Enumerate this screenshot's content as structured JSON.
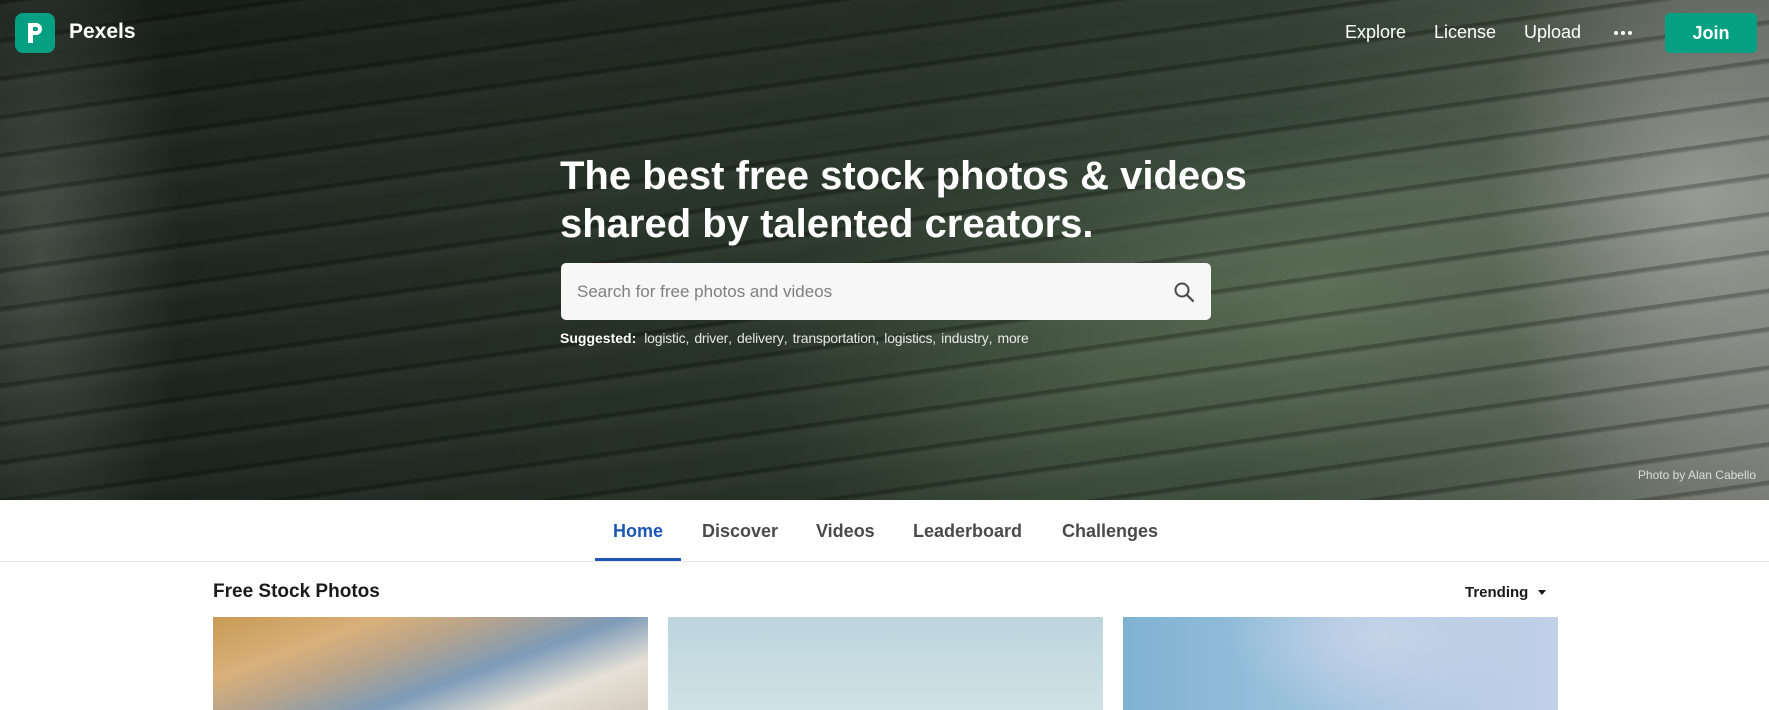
{
  "app": {
    "brand": "Pexels",
    "logo_letter": "P"
  },
  "nav": {
    "links": [
      "Explore",
      "License",
      "Upload"
    ],
    "more_icon": "more-horizontal-icon",
    "join_label": "Join"
  },
  "hero": {
    "headline_line1": "The best free stock photos & videos",
    "headline_line2": "shared by talented creators.",
    "search_placeholder": "Search for free photos and videos",
    "search_value": "",
    "suggested_label": "Suggested:",
    "suggestions": [
      "logistic",
      "driver",
      "delivery",
      "transportation",
      "logistics",
      "industry",
      "more"
    ],
    "credit": "Photo by Alan Cabello"
  },
  "tabs": {
    "items": [
      "Home",
      "Discover",
      "Videos",
      "Leaderboard",
      "Challenges"
    ],
    "active": "Home"
  },
  "section": {
    "title": "Free Stock Photos",
    "sort_value": "Trending"
  },
  "colors": {
    "brand": "#05a081",
    "tab_active": "#1c57b5"
  }
}
